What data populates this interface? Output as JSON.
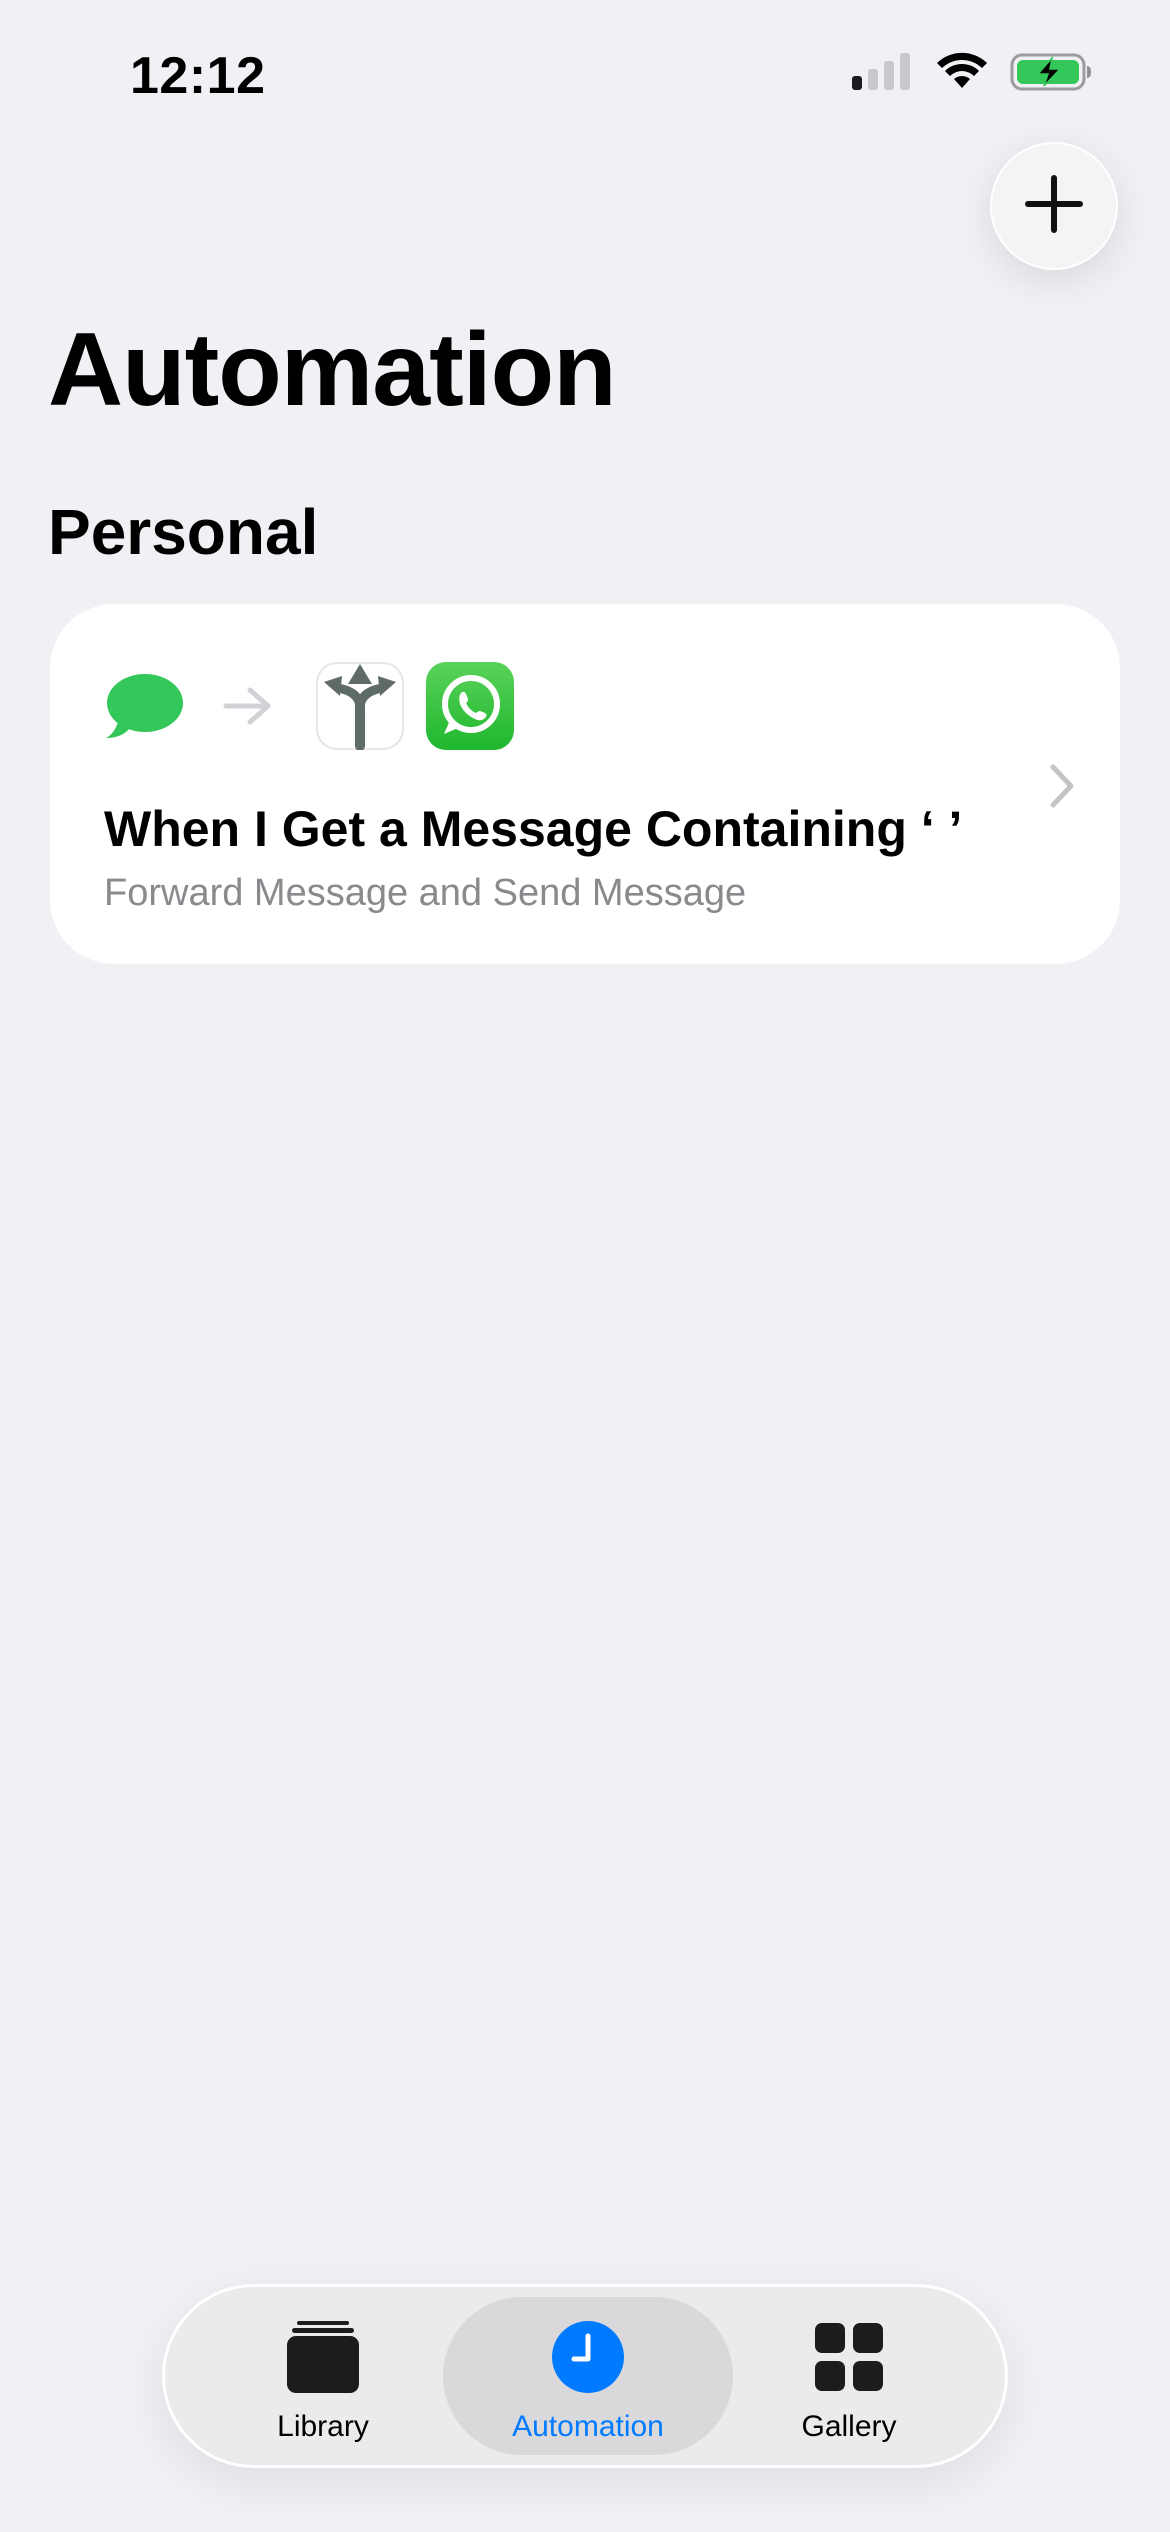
{
  "status_bar": {
    "time": "12:12",
    "icons": [
      "cellular-signal-icon",
      "wifi-icon",
      "battery-charging-icon"
    ],
    "battery_color": "#34c759"
  },
  "header": {
    "add_icon": "plus-icon",
    "title": "Automation"
  },
  "section": {
    "title": "Personal"
  },
  "automations": [
    {
      "trigger_icon": "messages-icon",
      "action_icons": [
        "split-arrow-shortcut-icon",
        "whatsapp-icon"
      ],
      "title": "When I Get a Message Containing ‘ ’",
      "subtitle": "Forward Message and Send Message"
    }
  ],
  "tab_bar": {
    "active_color": "#007aff",
    "tabs": [
      {
        "label": "Library",
        "icon": "library-stack-icon",
        "active": false
      },
      {
        "label": "Automation",
        "icon": "clock-icon",
        "active": true
      },
      {
        "label": "Gallery",
        "icon": "grid-icon",
        "active": false
      }
    ]
  }
}
